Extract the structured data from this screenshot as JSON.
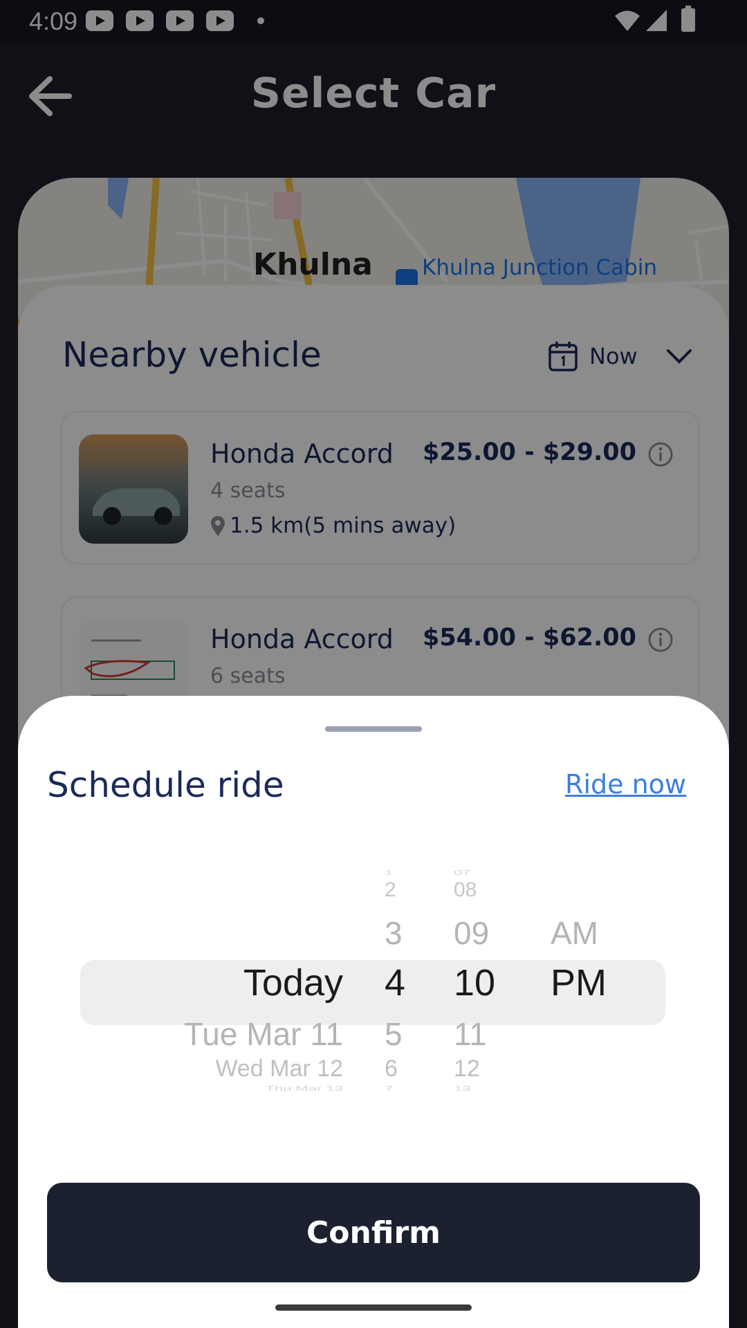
{
  "status_bar": {
    "time": "4:09"
  },
  "header": {
    "title": "Select Car"
  },
  "map": {
    "city": "Khulna",
    "poi": "Khulna Junction Cabin"
  },
  "nearby": {
    "title": "Nearby vehicle",
    "when_label": "Now",
    "cars": [
      {
        "name": "Honda Accord",
        "seats": "4 seats",
        "distance": "1.5 km(5 mins away)",
        "price": "$25.00 - $29.00"
      },
      {
        "name": "Honda Accord",
        "seats": "6 seats",
        "distance": "",
        "price": "$54.00 - $62.00"
      }
    ]
  },
  "sheet": {
    "title": "Schedule ride",
    "ride_now": "Ride now",
    "picker": {
      "dates": {
        "items": [
          "Today",
          "Tue Mar 11",
          "Wed Mar 12",
          "Thu Mar 13"
        ],
        "selected": "Today"
      },
      "hours": {
        "items": [
          "1",
          "2",
          "3",
          "4",
          "5",
          "6",
          "7"
        ],
        "selected": "4"
      },
      "minutes": {
        "items": [
          "07",
          "08",
          "09",
          "10",
          "11",
          "12",
          "13"
        ],
        "selected": "10"
      },
      "ampm": {
        "items": [
          "AM",
          "PM"
        ],
        "selected": "PM"
      }
    },
    "confirm": "Confirm"
  },
  "colors": {
    "accent_link": "#3d7de0",
    "primary_dark": "#1c2130",
    "title_navy": "#1b2a5a"
  }
}
